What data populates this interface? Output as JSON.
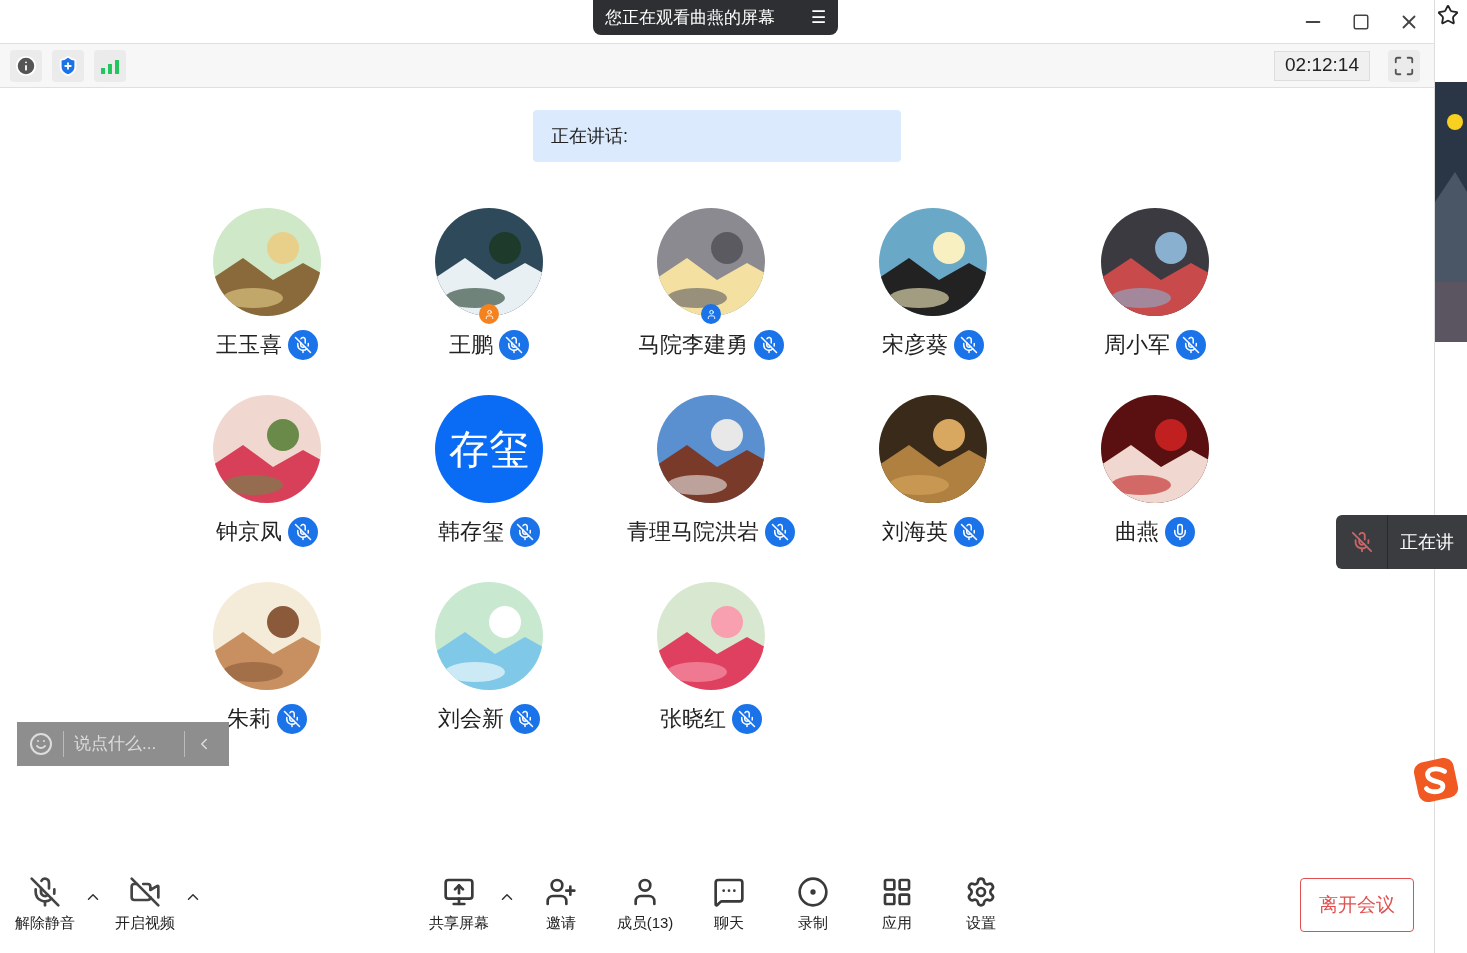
{
  "title_pill": {
    "text": "您正在观看曲燕的屏幕",
    "menu_icon": "☰"
  },
  "timer": "02:12:14",
  "speaking_banner": {
    "label": "正在讲话:"
  },
  "participants": [
    {
      "name": "王玉喜",
      "muted": true
    },
    {
      "name": "王鹏",
      "badge": {
        "color": "#f5821f"
      },
      "muted": true
    },
    {
      "name": "马院李建勇",
      "badge": {
        "color": "#1a73e8"
      },
      "muted": true
    },
    {
      "name": "宋彦葵",
      "muted": true
    },
    {
      "name": "周小军",
      "muted": true
    },
    {
      "name": "钟京凤",
      "muted": true
    },
    {
      "name": "韩存玺",
      "avatar": {
        "kind": "text",
        "text": "存玺"
      },
      "muted": true
    },
    {
      "name": "青理马院洪岩",
      "muted": true
    },
    {
      "name": "刘海英",
      "muted": true
    },
    {
      "name": "曲燕",
      "muted": false
    },
    {
      "name": "朱莉",
      "muted": true
    },
    {
      "name": "刘会新",
      "muted": true
    },
    {
      "name": "张晓红",
      "muted": true
    }
  ],
  "chat_input": {
    "placeholder": "说点什么..."
  },
  "speaking_toast": {
    "text": "正在讲",
    "muted": true
  },
  "toolbar_left": [
    {
      "kind": "mic",
      "label": "解除静音",
      "has_menu": true
    },
    {
      "kind": "video",
      "label": "开启视频",
      "has_menu": true
    }
  ],
  "toolbar_center": [
    {
      "kind": "share",
      "label": "共享屏幕",
      "has_menu": true
    },
    {
      "kind": "invite",
      "label": "邀请",
      "has_menu": false
    },
    {
      "kind": "members",
      "label": "成员(13)",
      "has_menu": false
    },
    {
      "kind": "chat",
      "label": "聊天",
      "has_menu": false
    },
    {
      "kind": "record",
      "label": "录制",
      "has_menu": false
    },
    {
      "kind": "apps",
      "label": "应用",
      "has_menu": false
    },
    {
      "kind": "settings",
      "label": "设置",
      "has_menu": false
    }
  ],
  "leave_button": "离开会议"
}
